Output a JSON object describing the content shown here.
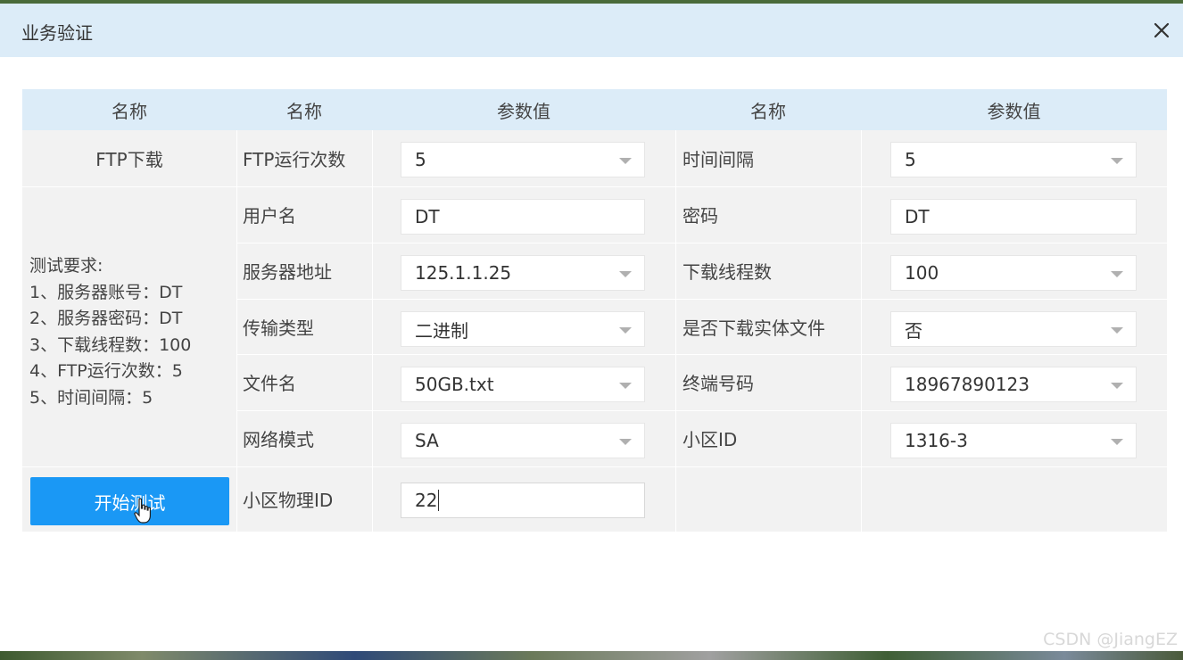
{
  "dialog": {
    "title": "业务验证",
    "close_symbol": "×"
  },
  "table": {
    "headers": [
      "名称",
      "名称",
      "参数值",
      "名称",
      "参数值"
    ],
    "section_label": "FTP下载",
    "requirements_title": "测试要求:",
    "requirements": [
      "1、服务器账号：DT",
      "2、服务器密码：DT",
      "3、下载线程数：100",
      "4、FTP运行次数：5",
      "5、时间间隔：5"
    ],
    "rows": [
      {
        "label1": "FTP运行次数",
        "value1": "5",
        "label2": "时间间隔",
        "value2": "5"
      },
      {
        "label1": "用户名",
        "value1": "DT",
        "label2": "密码",
        "value2": "DT"
      },
      {
        "label1": "服务器地址",
        "value1": "125.1.1.25",
        "label2": "下载线程数",
        "value2": "100"
      },
      {
        "label1": "传输类型",
        "value1": "二进制",
        "label2": "是否下载实体文件",
        "value2": "否"
      },
      {
        "label1": "文件名",
        "value1": "50GB.txt",
        "label2": "终端号码",
        "value2": "18967890123"
      },
      {
        "label1": "网络模式",
        "value1": "SA",
        "label2": "小区ID",
        "value2": "1316-3"
      },
      {
        "label1": "小区物理ID",
        "value1": "22"
      }
    ]
  },
  "start_button_label": "开始测试",
  "watermark": "CSDN @JiangEZ",
  "colors": {
    "titlebar": "#dcecf8",
    "header": "#dcecf8",
    "button": "#1a98f5",
    "table_bg": "#f2f2f2"
  }
}
